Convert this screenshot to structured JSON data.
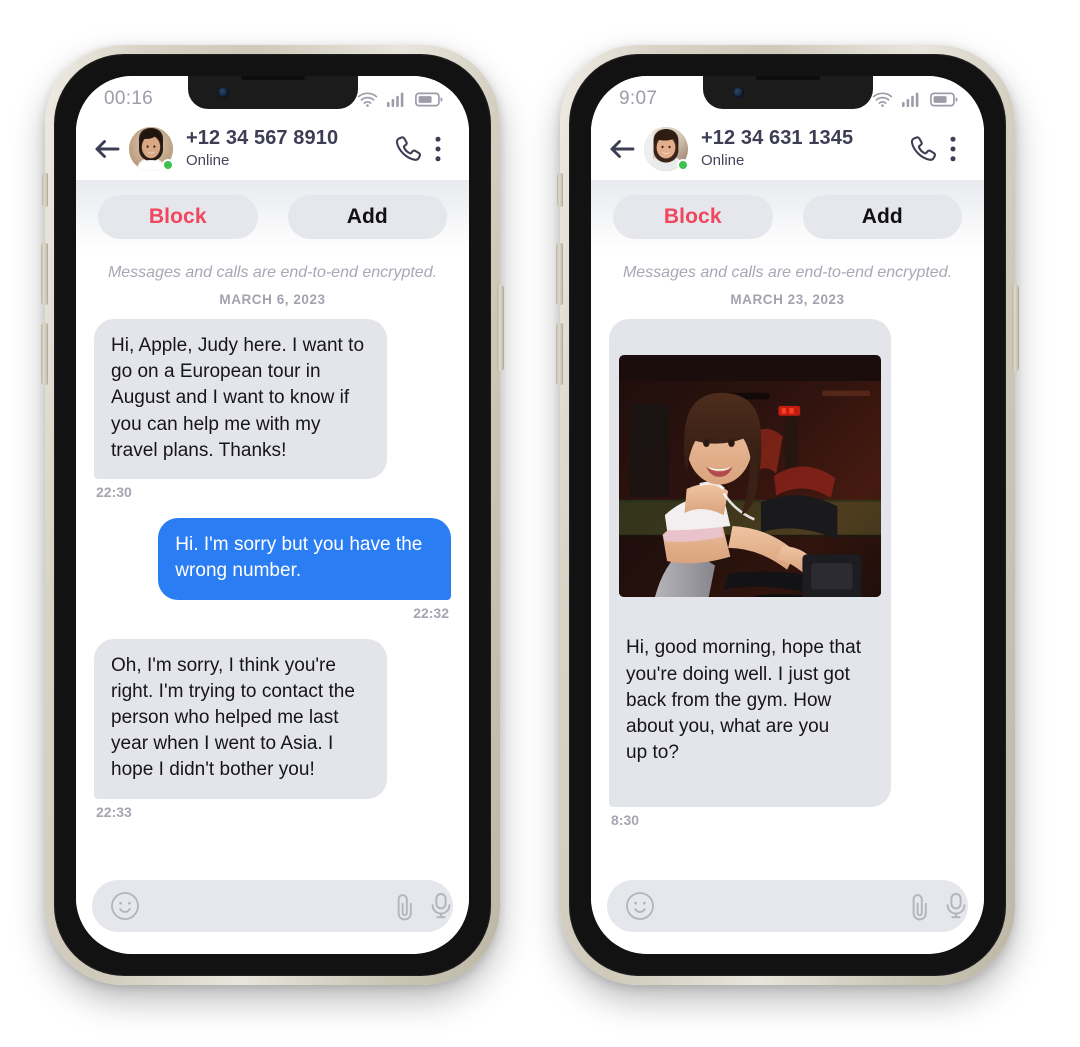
{
  "app": {
    "name": "Messaging App",
    "accent_blue": "#2b7df4",
    "bubble_gray": "#e4e5ea",
    "block_red": "#f0465e",
    "online_green": "#3ec14f",
    "frame_beige": "#d8d3c6"
  },
  "phones": [
    {
      "id": "phone-left",
      "status_bar": {
        "time": "00:16",
        "wifi": "wifi-icon",
        "signal": "cellular-signal-icon",
        "battery": "battery-icon"
      },
      "header": {
        "back": "back-arrow-icon",
        "avatar": "contact-avatar",
        "phone_number": "+12 34 567 8910",
        "presence": "Online",
        "call": "phone-call-icon",
        "more": "more-vertical-icon"
      },
      "actions": {
        "block_label": "Block",
        "add_label": "Add"
      },
      "encryption_notice": "Messages and calls are end-to-end encrypted.",
      "date_separator": "MARCH 6, 2023",
      "messages": [
        {
          "direction": "in",
          "type": "text",
          "text": "Hi, Apple, Judy here. I want to go on a European tour in August and I want to know if you can help me with my travel plans. Thanks!",
          "time": "22:30"
        },
        {
          "direction": "out",
          "type": "text",
          "text": "Hi. I'm sorry but you have the wrong number.",
          "time": "22:32"
        },
        {
          "direction": "in",
          "type": "text",
          "text": "Oh, I'm sorry, I think you're right. I'm trying to contact the person who helped me last year when I went to Asia. I hope I didn't bother you!",
          "time": "22:33"
        }
      ],
      "input_bar": {
        "emoji": "smiley-face-icon",
        "placeholder": "",
        "value": "",
        "attach": "paperclip-icon",
        "mic": "microphone-icon"
      }
    },
    {
      "id": "phone-right",
      "status_bar": {
        "time": "9:07",
        "wifi": "wifi-icon",
        "signal": "cellular-signal-icon",
        "battery": "battery-icon"
      },
      "header": {
        "back": "back-arrow-icon",
        "avatar": "contact-avatar",
        "phone_number": "+12 34 631 1345",
        "presence": "Online",
        "call": "phone-call-icon",
        "more": "more-vertical-icon"
      },
      "actions": {
        "block_label": "Block",
        "add_label": "Add"
      },
      "encryption_notice": "Messages and calls are end-to-end encrypted.",
      "date_separator": "MARCH 23, 2023",
      "messages": [
        {
          "direction": "in",
          "type": "media",
          "media_alt": "woman-on-exercise-bike-at-gym-photo",
          "text": "Hi, good morning, hope that you're doing well. I just got back from the gym. How about you, what are you\nup to?",
          "time": "8:30"
        }
      ],
      "input_bar": {
        "emoji": "smiley-face-icon",
        "placeholder": "",
        "value": "",
        "attach": "paperclip-icon",
        "mic": "microphone-icon"
      }
    }
  ]
}
